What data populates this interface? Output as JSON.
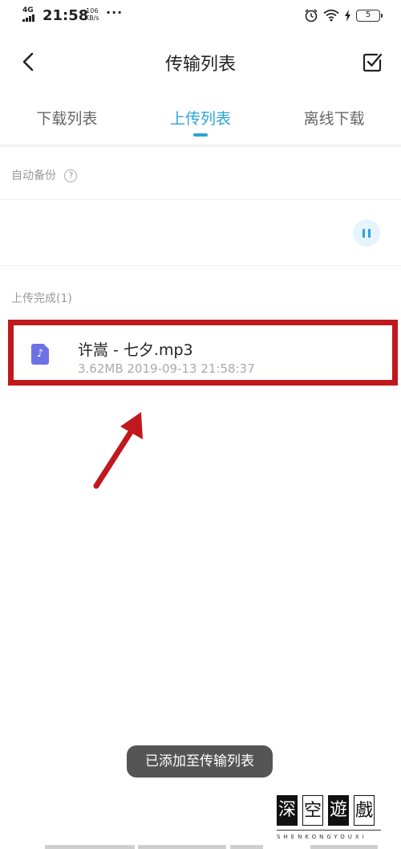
{
  "status_bar": {
    "network": "4G",
    "time": "21:58",
    "speed_value": "106",
    "speed_unit": "KB/s",
    "more": "···",
    "battery": "5"
  },
  "header": {
    "title": "传输列表"
  },
  "tabs": [
    {
      "label": "下载列表",
      "active": false
    },
    {
      "label": "上传列表",
      "active": true
    },
    {
      "label": "离线下载",
      "active": false
    }
  ],
  "auto_backup": {
    "label": "自动备份",
    "help": "?"
  },
  "completed": {
    "label": "上传完成(1)",
    "files": [
      {
        "name": "许嵩 - 七夕.mp3",
        "size": "3.62MB",
        "datetime": "2019-09-13 21:58:37",
        "icon": "music-file-icon"
      }
    ]
  },
  "toast": {
    "text": "已添加至传输列表"
  },
  "watermark": {
    "chars": [
      "深",
      "空",
      "遊",
      "戲"
    ],
    "sub": "SHENKONGYOUXI"
  },
  "colors": {
    "accent": "#2aa3d8",
    "highlight_box": "#c0181c",
    "file_icon": "#6c72e6"
  }
}
